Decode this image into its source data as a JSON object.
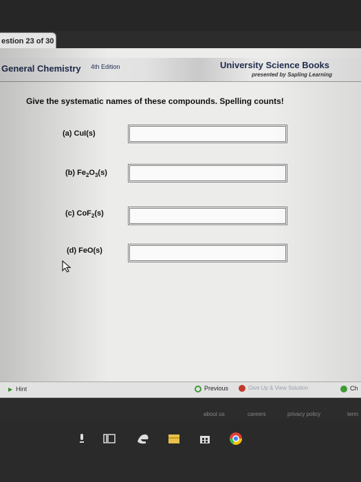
{
  "question_counter": "estion 23 of 30",
  "header": {
    "book_title": "General Chemistry",
    "edition": "4th Edition",
    "publisher": "University Science Books",
    "presented_by": "presented by Sapling Learning"
  },
  "prompt": "Give the systematic names of these compounds. Spelling counts!",
  "questions": [
    {
      "label": "(a) CuI(s)",
      "value": ""
    },
    {
      "label_prefix": "(b) Fe",
      "sub1": "2",
      "mid": "O",
      "sub2": "3",
      "suffix": "(s)",
      "value": ""
    },
    {
      "label_prefix": "(c) CoF",
      "sub1": "2",
      "suffix": "(s)",
      "value": ""
    },
    {
      "label": "(d) FeO(s)",
      "value": ""
    }
  ],
  "footer": {
    "hint": "Hint",
    "previous": "Previous",
    "give_up": "Give Up & View Solution",
    "check": "Ch"
  },
  "links": {
    "about": "about us",
    "careers": "careers",
    "privacy": "privacy policy",
    "terms": "term"
  },
  "colors": {
    "header_text": "#1f2c4e",
    "check_green": "#3e9a35",
    "give_up_red": "#c0392b"
  }
}
